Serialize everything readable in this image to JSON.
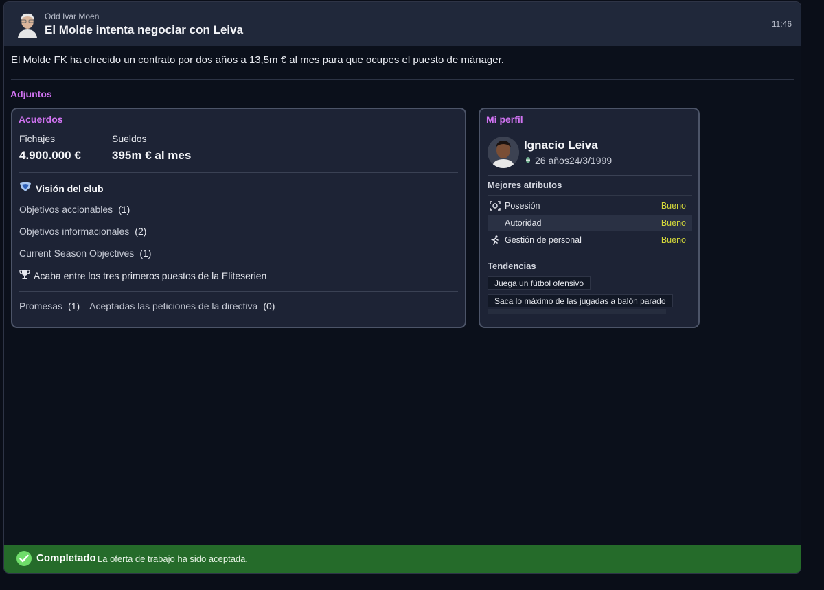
{
  "header": {
    "sender": "Odd Ivar Moen",
    "title": "El Molde intenta negociar con Leiva",
    "time": "11:46"
  },
  "message": "El Molde FK ha ofrecido un contrato por dos años a 13,5m € al mes para que ocupes el puesto de mánager.",
  "attachments_label": "Adjuntos",
  "deals": {
    "title": "Acuerdos",
    "fees_label": "Fichajes",
    "fees_value": "4.900.000 €",
    "wages_label": "Sueldos",
    "wages_value": "395m € al mes",
    "vision_title": "Visión del club",
    "objectives": [
      {
        "label": "Objetivos accionables",
        "count": "(1)"
      },
      {
        "label": "Objetivos informacionales",
        "count": "(2)"
      },
      {
        "label": "Current Season Objectives",
        "count": "(1)"
      }
    ],
    "trophy_objective": "Acaba entre los tres primeros puestos de la Eliteserien",
    "promises_label": "Promesas",
    "promises_count": "(1)",
    "board_label": "Aceptadas las peticiones de la directiva",
    "board_count": "(0)"
  },
  "profile": {
    "title": "Mi perfil",
    "name": "Ignacio Leiva",
    "meta": "26 años24/3/1999",
    "best_attributes_label": "Mejores atributos",
    "attributes": [
      {
        "label": "Posesión",
        "value": "Bueno",
        "icon": "possession-icon"
      },
      {
        "label": "Autoridad",
        "value": "Bueno",
        "icon": ""
      },
      {
        "label": "Gestión de personal",
        "value": "Bueno",
        "icon": "running-person-icon"
      }
    ],
    "tendencies_label": "Tendencias",
    "tendencies": [
      "Juega un fútbol ofensivo",
      "Saca lo máximo de las jugadas a balón parado"
    ]
  },
  "status": {
    "title": "Completado",
    "text": "La oferta de trabajo ha sido aceptada.",
    "color": "#256b2a"
  }
}
